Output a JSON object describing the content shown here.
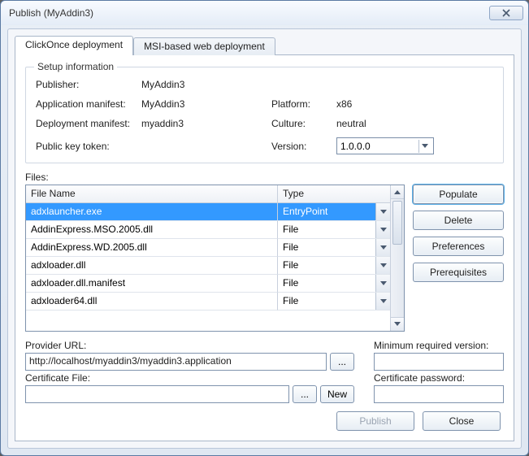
{
  "window": {
    "title": "Publish (MyAddin3)"
  },
  "tabs": [
    {
      "label": "ClickOnce deployment",
      "active": true
    },
    {
      "label": "MSI-based web deployment",
      "active": false
    }
  ],
  "setup": {
    "legend": "Setup information",
    "publisher_label": "Publisher:",
    "publisher_value": "MyAddin3",
    "appmanifest_label": "Application manifest:",
    "appmanifest_value": "MyAddin3",
    "depmanifest_label": "Deployment manifest:",
    "depmanifest_value": "myaddin3",
    "pubkey_label": "Public key token:",
    "pubkey_value": "",
    "platform_label": "Platform:",
    "platform_value": "x86",
    "culture_label": "Culture:",
    "culture_value": "neutral",
    "version_label": "Version:",
    "version_value": "1.0.0.0"
  },
  "files": {
    "label": "Files:",
    "header_name": "File Name",
    "header_type": "Type",
    "rows": [
      {
        "name": "adxlauncher.exe",
        "type": "EntryPoint",
        "selected": true
      },
      {
        "name": "AddinExpress.MSO.2005.dll",
        "type": "File",
        "selected": false
      },
      {
        "name": "AddinExpress.WD.2005.dll",
        "type": "File",
        "selected": false
      },
      {
        "name": "adxloader.dll",
        "type": "File",
        "selected": false
      },
      {
        "name": "adxloader.dll.manifest",
        "type": "File",
        "selected": false
      },
      {
        "name": "adxloader64.dll",
        "type": "File",
        "selected": false
      }
    ]
  },
  "side": {
    "populate": "Populate",
    "delete": "Delete",
    "preferences": "Preferences",
    "prerequisites": "Prerequisites"
  },
  "provider": {
    "label": "Provider URL:",
    "value": "http://localhost/myaddin3/myaddin3.application",
    "browse": "..."
  },
  "minver": {
    "label": "Minimum required version:",
    "value": ""
  },
  "cert": {
    "label": "Certificate File:",
    "value": "",
    "browse": "...",
    "new": "New"
  },
  "certpass": {
    "label": "Certificate password:",
    "value": ""
  },
  "footer": {
    "publish": "Publish",
    "close": "Close"
  }
}
